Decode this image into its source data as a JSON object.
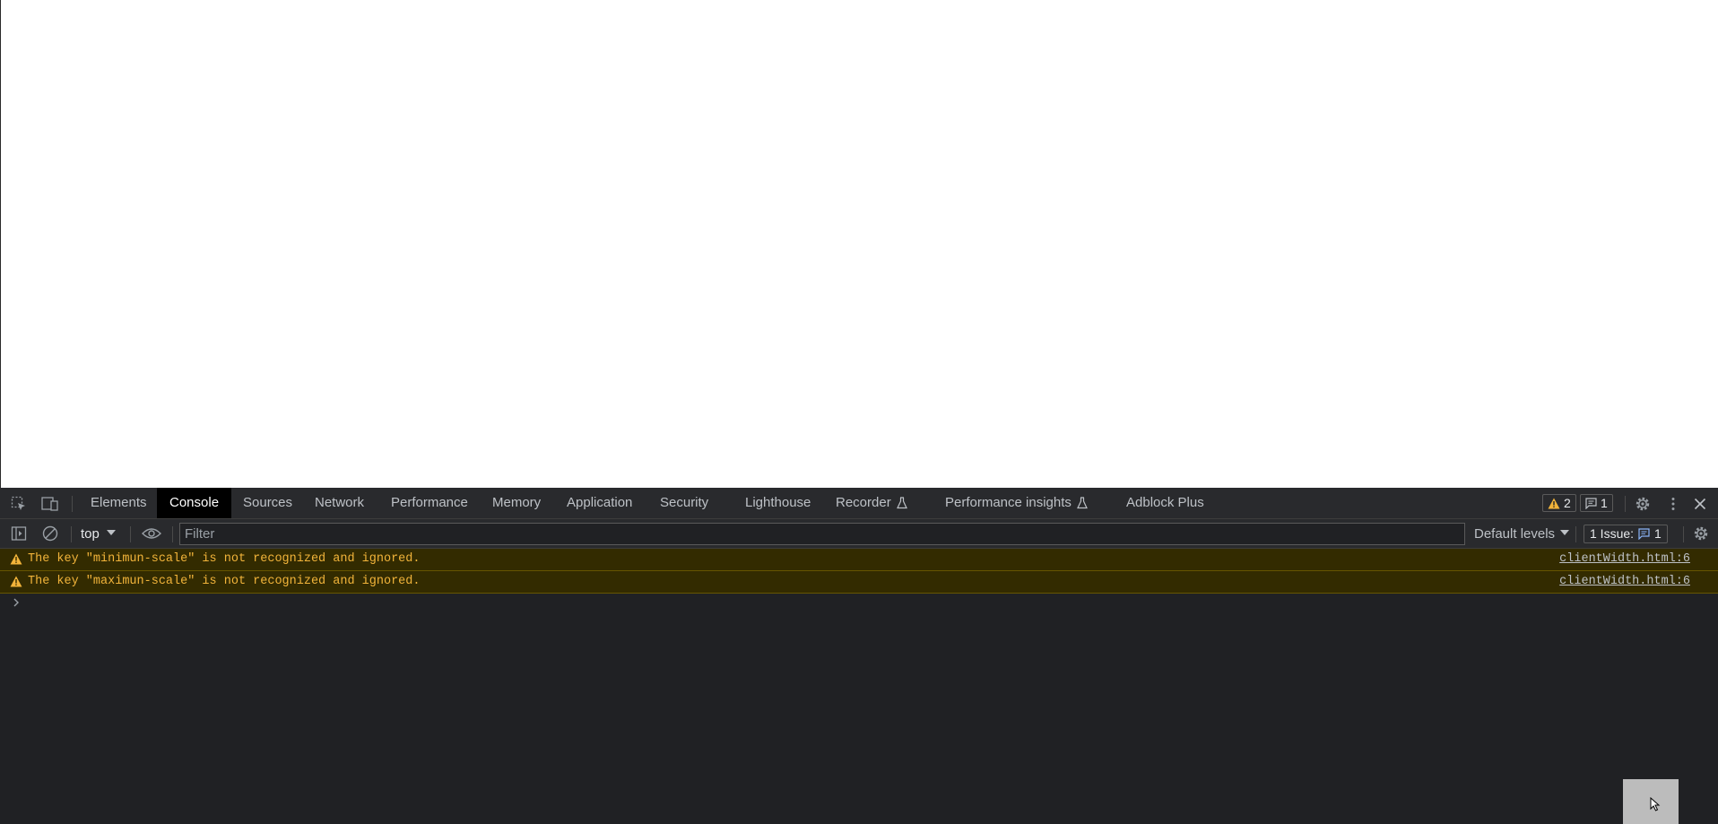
{
  "devtools": {
    "tabs": [
      "Elements",
      "Console",
      "Sources",
      "Network",
      "Performance",
      "Memory",
      "Application",
      "Security",
      "Lighthouse",
      "Recorder",
      "Performance insights",
      "Adblock Plus"
    ],
    "active_tab": "Console",
    "warnings_count": "2",
    "messages_count": "1"
  },
  "toolbar": {
    "context": "top",
    "filter_placeholder": "Filter",
    "levels": "Default levels",
    "issues_label": "1 Issue:",
    "issues_count": "1"
  },
  "console": {
    "messages": [
      {
        "level": "warning",
        "text": "The key \"minimun-scale\" is not recognized and ignored.",
        "source": "clientWidth.html:6"
      },
      {
        "level": "warning",
        "text": "The key \"maximun-scale\" is not recognized and ignored.",
        "source": "clientWidth.html:6"
      }
    ]
  },
  "colors": {
    "panel_bg": "#202124",
    "bar_bg": "#292a2d",
    "warning_bg": "#332b00",
    "warning_text": "#f2b43a",
    "accent_blue": "#8ab4f8"
  }
}
